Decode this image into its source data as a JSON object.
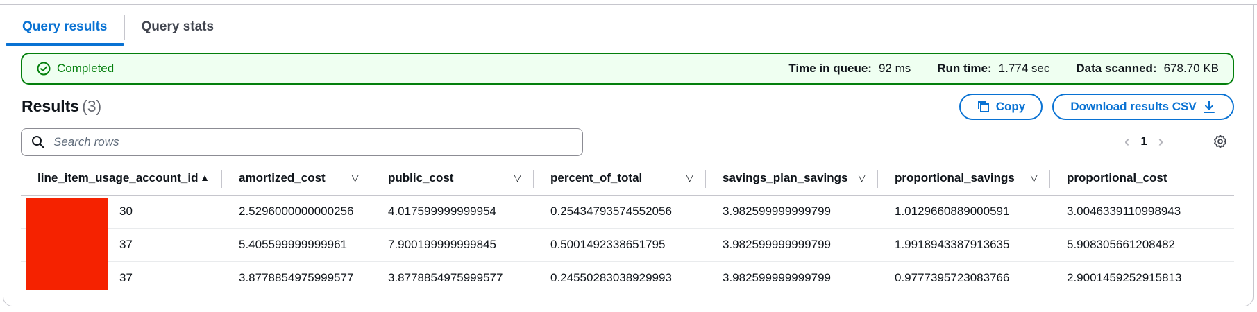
{
  "tabs": [
    {
      "label": "Query results",
      "active": true
    },
    {
      "label": "Query stats",
      "active": false
    }
  ],
  "status": {
    "label": "Completed",
    "time_in_queue_label": "Time in queue:",
    "time_in_queue_value": "92 ms",
    "run_time_label": "Run time:",
    "run_time_value": "1.774 sec",
    "data_scanned_label": "Data scanned:",
    "data_scanned_value": "678.70 KB",
    "color": "#037f0c"
  },
  "results": {
    "title": "Results",
    "count": "(3)"
  },
  "buttons": {
    "copy": "Copy",
    "download": "Download results CSV"
  },
  "search": {
    "placeholder": "Search rows",
    "value": ""
  },
  "pagination": {
    "current_page": "1"
  },
  "table": {
    "columns": [
      {
        "label": "line_item_usage_account_id",
        "sort": "▲"
      },
      {
        "label": "amortized_cost",
        "sort": "▽"
      },
      {
        "label": "public_cost",
        "sort": "▽"
      },
      {
        "label": "percent_of_total",
        "sort": "▽"
      },
      {
        "label": "savings_plan_savings",
        "sort": "▽"
      },
      {
        "label": "proportional_savings",
        "sort": "▽"
      },
      {
        "label": "proportional_cost",
        "sort": ""
      }
    ],
    "rows": [
      [
        "30",
        "2.5296000000000256",
        "4.017599999999954",
        "0.25434793574552056",
        "3.982599999999799",
        "1.0129660889000591",
        "3.0046339110998943"
      ],
      [
        "37",
        "5.405599999999961",
        "7.900199999999845",
        "0.5001492338651795",
        "3.982599999999799",
        "1.9918943387913635",
        "5.908305661208482"
      ],
      [
        "37",
        "3.8778854975999577",
        "3.8778854975999577",
        "0.24550283038929993",
        "3.982599999999799",
        "0.9777395723083766",
        "2.9001459252915813"
      ]
    ]
  },
  "colors": {
    "accent": "#0972d3",
    "success": "#037f0c",
    "redaction": "#f52200"
  }
}
